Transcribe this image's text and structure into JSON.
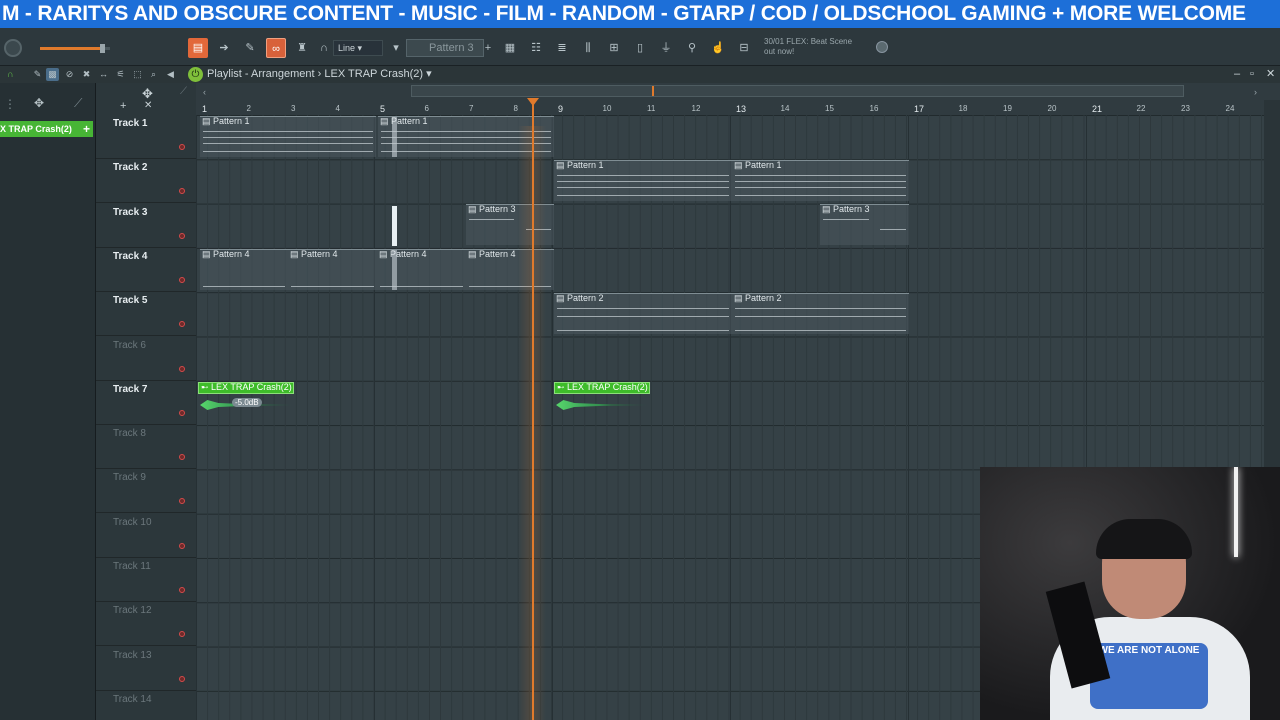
{
  "banner": {
    "text": "M  - RARITYS AND OBSCURE CONTENT - MUSIC - FILM - RANDOM - GTARP / COD / OLDSCHOOL GAMING + MORE  WELCOME"
  },
  "toolbar": {
    "snap": "Line",
    "pattern": "Pattern 3",
    "hint_line1": "30/01  FLEX: Beat Scene",
    "hint_line2": "out now!"
  },
  "playlist": {
    "title": "Playlist - Arrangement",
    "sep": "›",
    "clip": "LEX TRAP Crash(2)"
  },
  "browser": {
    "selected": "X TRAP Crash(2)"
  },
  "ruler": {
    "bars": [
      "1",
      "2",
      "3",
      "4",
      "5",
      "6",
      "7",
      "8",
      "9",
      "10",
      "11",
      "12",
      "13",
      "14",
      "15",
      "16",
      "17",
      "18",
      "19",
      "20",
      "21",
      "22",
      "23",
      "24"
    ]
  },
  "tracks": [
    "Track 1",
    "Track 2",
    "Track 3",
    "Track 4",
    "Track 5",
    "Track 6",
    "Track 7",
    "Track 8",
    "Track 9",
    "Track 10",
    "Track 11",
    "Track 12",
    "Track 13",
    "Track 14"
  ],
  "clips": {
    "p1": "Pattern 1",
    "p2": "Pattern 2",
    "p3": "Pattern 3",
    "p4": "Pattern 4",
    "audio": "LEX TRAP Crash(2)",
    "gain": "-5.0dB"
  },
  "webcam": {
    "shirt": "WE ARE NOT ALONE"
  },
  "colors": {
    "accent": "#e07a2c",
    "audio_clip": "#3ebc2a",
    "banner": "#1d6fd8"
  }
}
